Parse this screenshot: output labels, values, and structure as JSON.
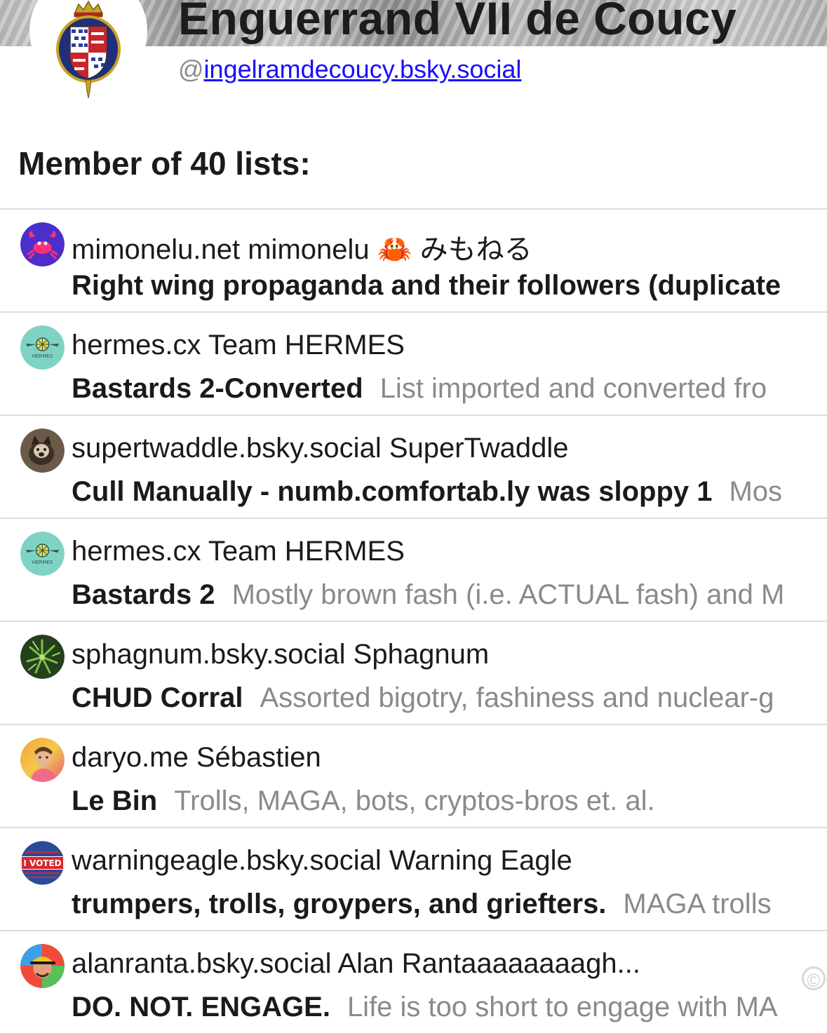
{
  "profile": {
    "name": "Enguerrand VII de Coucy",
    "at": "@",
    "handle": "ingelramdecoucy.bsky.social"
  },
  "section_title": "Member of 40 lists:",
  "lists": [
    {
      "owner": "mimonelu.net mimonelu 🦀 みもねる",
      "name": "Right wing propaganda and their followers (duplicate",
      "description": "",
      "avatar": "crab-icon"
    },
    {
      "owner": "hermes.cx Team HERMES",
      "name": "Bastards 2-Converted",
      "description": "List imported and converted fro",
      "avatar": "hermes-logo-icon"
    },
    {
      "owner": "supertwaddle.bsky.social SuperTwaddle",
      "name": "Cull Manually - numb.comfortab.ly was sloppy 1",
      "description": "Mos",
      "avatar": "cat-photo-icon"
    },
    {
      "owner": "hermes.cx Team HERMES",
      "name": "Bastards 2",
      "description": "Mostly brown fash (i.e. ACTUAL fash) and M",
      "avatar": "hermes-logo-icon"
    },
    {
      "owner": "sphagnum.bsky.social Sphagnum",
      "name": "CHUD Corral",
      "description": "Assorted bigotry, fashiness and nuclear-g",
      "avatar": "plant-photo-icon"
    },
    {
      "owner": "daryo.me Sébastien",
      "name": "Le Bin",
      "description": "Trolls, MAGA, bots, cryptos-bros et. al.",
      "avatar": "person-photo-icon"
    },
    {
      "owner": "warningeagle.bsky.social Warning Eagle",
      "name": "trumpers, trolls, groypers, and griefters.",
      "description": "MAGA trolls",
      "avatar": "i-voted-sticker-icon"
    },
    {
      "owner": "alanranta.bsky.social Alan Rantaaaaaaaagh...",
      "name": "DO. NOT. ENGAGE.",
      "description": "Life is too short to engage with MA",
      "avatar": "person-cap-photo-icon"
    }
  ],
  "colors": {
    "handle_link": "#1a0dff",
    "description_gray": "#8a8a8a",
    "divider": "#dcdcdc",
    "hermes_teal": "#7fd3c4",
    "crab_purple": "#4b2fc9"
  }
}
